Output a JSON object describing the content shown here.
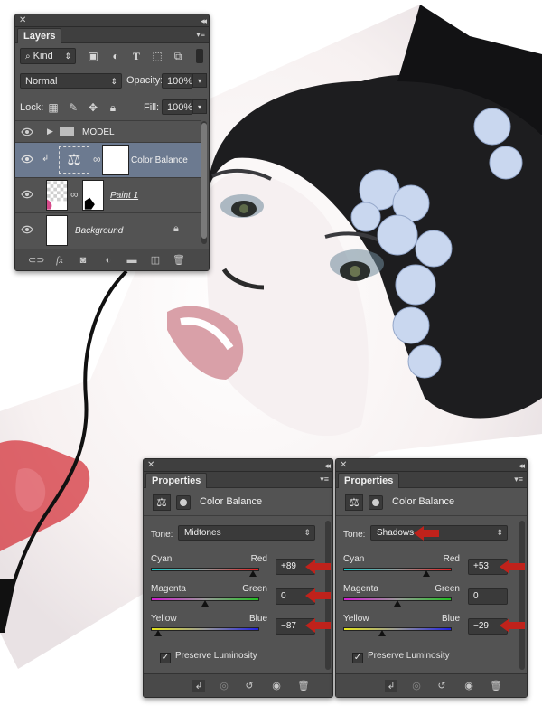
{
  "layers_panel": {
    "tab_label": "Layers",
    "filter_label": "Kind",
    "blend_mode": "Normal",
    "opacity_label": "Opacity:",
    "opacity_value": "100%",
    "lock_label": "Lock:",
    "fill_label": "Fill:",
    "fill_value": "100%",
    "layers": [
      {
        "name": "MODEL",
        "type": "group"
      },
      {
        "name": "Color Balance",
        "type": "adjustment",
        "selected": true
      },
      {
        "name": "Paint 1",
        "type": "pixel"
      },
      {
        "name": "Background",
        "type": "background",
        "locked": true
      }
    ],
    "footer_icons": [
      "link-icon",
      "fx-icon",
      "mask-icon",
      "adjustment-icon",
      "folder-icon",
      "new-layer-icon",
      "trash-icon"
    ]
  },
  "properties_panels": [
    {
      "tab_label": "Properties",
      "title": "Color Balance",
      "tone_label": "Tone:",
      "tone_value": "Midtones",
      "sliders": [
        {
          "left": "Cyan",
          "right": "Red",
          "value": "+89",
          "level": 89,
          "gradient": [
            "#19c7c7",
            "#e02020"
          ]
        },
        {
          "left": "Magenta",
          "right": "Green",
          "value": "0",
          "level": 0,
          "gradient": [
            "#d01fd0",
            "#22c022"
          ]
        },
        {
          "left": "Yellow",
          "right": "Blue",
          "value": "−87",
          "level": -87,
          "gradient": [
            "#e6e61c",
            "#2020e0"
          ]
        }
      ],
      "preserve_label": "Preserve Luminosity",
      "preserve_checked": true,
      "highlight_arrows": [
        "value-0",
        "value-1",
        "value-2"
      ]
    },
    {
      "tab_label": "Properties",
      "title": "Color Balance",
      "tone_label": "Tone:",
      "tone_value": "Shadows",
      "sliders": [
        {
          "left": "Cyan",
          "right": "Red",
          "value": "+53",
          "level": 53,
          "gradient": [
            "#19c7c7",
            "#e02020"
          ]
        },
        {
          "left": "Magenta",
          "right": "Green",
          "value": "0",
          "level": 0,
          "gradient": [
            "#d01fd0",
            "#22c022"
          ]
        },
        {
          "left": "Yellow",
          "right": "Blue",
          "value": "−29",
          "level": -29,
          "gradient": [
            "#e6e61c",
            "#2020e0"
          ]
        }
      ],
      "preserve_label": "Preserve Luminosity",
      "preserve_checked": true,
      "highlight_arrows": [
        "tone",
        "value-0",
        "value-2"
      ]
    }
  ],
  "colors": {
    "panel_bg": "#535353",
    "selected_layer": "#6c7a90",
    "arrow_red": "#c0221b"
  }
}
